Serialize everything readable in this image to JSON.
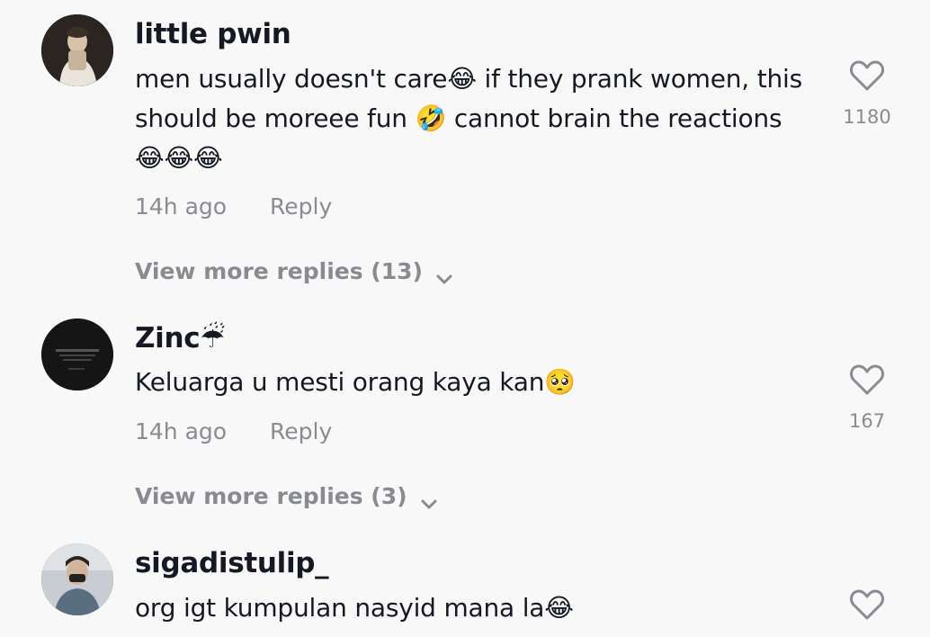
{
  "comments": [
    {
      "username": "little pwin",
      "text": "men usually doesn't care😂 if they prank women, this should be moreee fun 🤣 cannot brain the reactions 😂😂😂",
      "time": "14h ago",
      "reply_label": "Reply",
      "view_more": "View more replies (13)",
      "likes": "1180",
      "avatar_icon": "user-avatar"
    },
    {
      "username": "Zinc☔",
      "text": "Keluarga u mesti orang kaya kan🥺",
      "time": "14h ago",
      "reply_label": "Reply",
      "view_more": "View more replies (3)",
      "likes": "167",
      "avatar_icon": "user-avatar"
    },
    {
      "username": "sigadistulip_",
      "text": "org igt kumpulan nasyid mana la😂",
      "avatar_icon": "user-avatar"
    }
  ],
  "icons": {
    "like": "heart-outline-icon",
    "expand": "chevron-down-icon"
  },
  "colors": {
    "background": "#f8f8f8",
    "primary_text": "#161823",
    "secondary_text": "#8a8b91"
  }
}
